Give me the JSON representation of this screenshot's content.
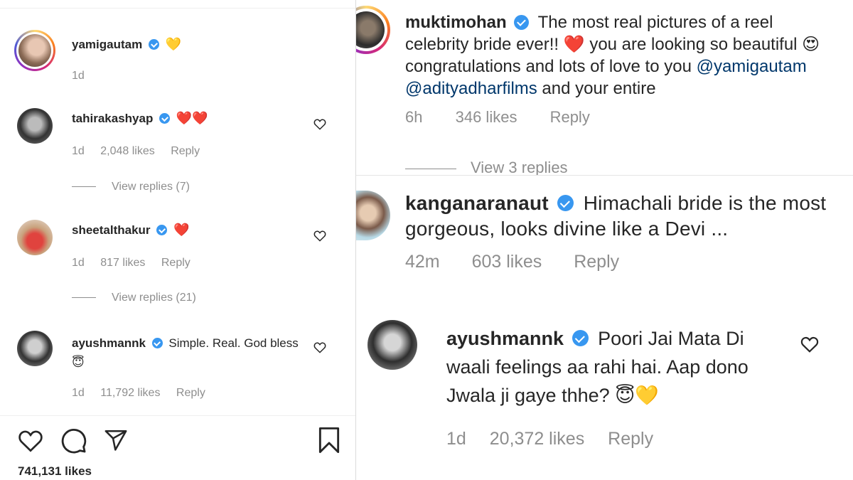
{
  "left": {
    "comments": [
      {
        "username": "yamigautam",
        "emoji": "💛",
        "time": "1d"
      },
      {
        "username": "tahirakashyap",
        "emoji": "❤️❤️",
        "time": "1d",
        "likes": "2,048 likes",
        "reply": "Reply",
        "view_replies": "View replies (7)"
      },
      {
        "username": "sheetalthakur",
        "emoji": "❤️",
        "time": "1d",
        "likes": "817 likes",
        "reply": "Reply",
        "view_replies": "View replies (21)"
      },
      {
        "username": "ayushmannk",
        "text": "Simple. Real. God bless😇",
        "time": "1d",
        "likes": "11,792 likes",
        "reply": "Reply"
      }
    ],
    "post_likes": "741,131 likes",
    "icons": [
      "heart-icon",
      "comment-icon",
      "share-icon",
      "bookmark-icon"
    ]
  },
  "right_top": {
    "username": "muktimohan",
    "text_a": "The most real pictures of a reel celebrity bride ever!! ❤️ you are looking so beautiful 😍congratulations and lots of love to you ",
    "mention1": "@yamigautam",
    "mention2": "@adityadharfilms",
    "text_b": " and your entire",
    "time": "6h",
    "likes": "346 likes",
    "reply": "Reply",
    "view_replies": "View 3 replies"
  },
  "right_mid": {
    "username": "kanganaranaut",
    "text": "Himachali bride is the most gorgeous, looks divine like a Devi ...",
    "time": "42m",
    "likes": "603 likes",
    "reply": "Reply"
  },
  "right_bot": {
    "username": "ayushmannk",
    "text": "Poori Jai Mata Di waali feelings aa rahi hai. Aap dono Jwala ji gaye thhe? 😇💛",
    "time": "1d",
    "likes": "20,372 likes",
    "reply": "Reply"
  },
  "colors": {
    "verified": "#3897f0",
    "muted": "#8e8e8e",
    "link": "#00376b"
  }
}
